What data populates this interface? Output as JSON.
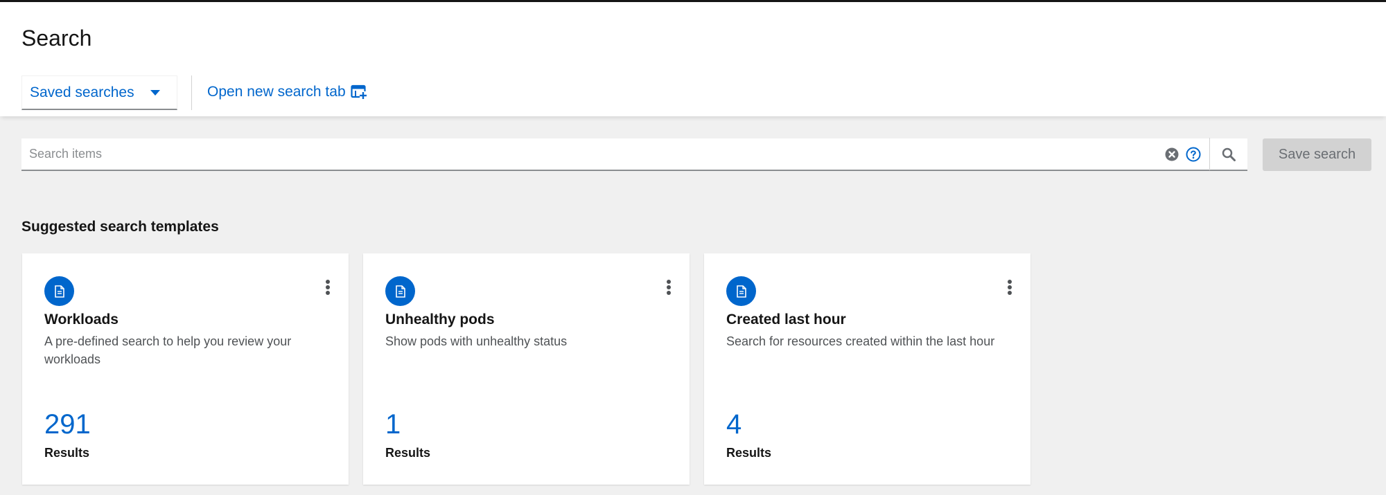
{
  "header": {
    "title": "Search",
    "saved_searches_label": "Saved searches",
    "open_tab_label": "Open new search tab"
  },
  "search": {
    "placeholder": "Search items",
    "value": "",
    "save_label": "Save search"
  },
  "templates": {
    "title": "Suggested search templates",
    "cards": [
      {
        "title": "Workloads",
        "description": "A pre-defined search to help you review your workloads",
        "count": "291",
        "count_label": "Results"
      },
      {
        "title": "Unhealthy pods",
        "description": "Show pods with unhealthy status",
        "count": "1",
        "count_label": "Results"
      },
      {
        "title": "Created last hour",
        "description": "Search for resources created within the last hour",
        "count": "4",
        "count_label": "Results"
      }
    ]
  },
  "colors": {
    "accent": "#0066cc",
    "background": "#f0f0f0",
    "disabled_button": "#d2d2d2"
  },
  "icons": [
    "caret-down-icon",
    "open-new-tab-icon",
    "clear-icon",
    "help-icon",
    "search-icon",
    "document-icon",
    "kebab-menu-icon"
  ]
}
